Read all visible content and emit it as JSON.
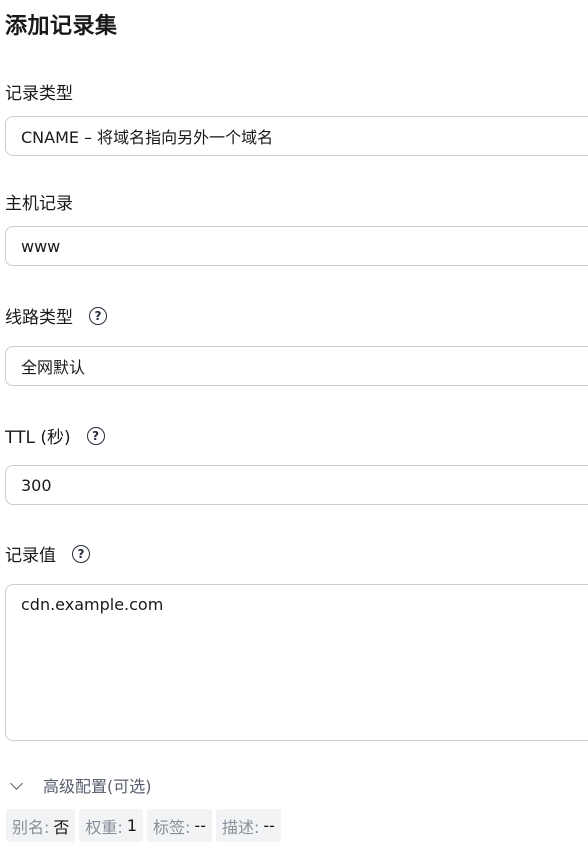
{
  "page_title": "添加记录集",
  "record_type": {
    "label": "记录类型",
    "value": "CNAME – 将域名指向另外一个域名"
  },
  "host_record": {
    "label": "主机记录",
    "value": "www"
  },
  "line_type": {
    "label": "线路类型",
    "value": "全网默认",
    "help_icon": "?"
  },
  "ttl": {
    "label": "TTL (秒)",
    "value": "300",
    "help_icon": "?"
  },
  "record_value": {
    "label": "记录值",
    "value": "cdn.example.com",
    "help_icon": "?"
  },
  "advanced": {
    "label": "高级配置(可选)",
    "icon": "chevron-down-icon"
  },
  "summary_tags": [
    {
      "key": "别名:",
      "value": "否"
    },
    {
      "key": "权重:",
      "value": "1"
    },
    {
      "key": "标签:",
      "value": "--"
    },
    {
      "key": "描述:",
      "value": "--"
    }
  ]
}
